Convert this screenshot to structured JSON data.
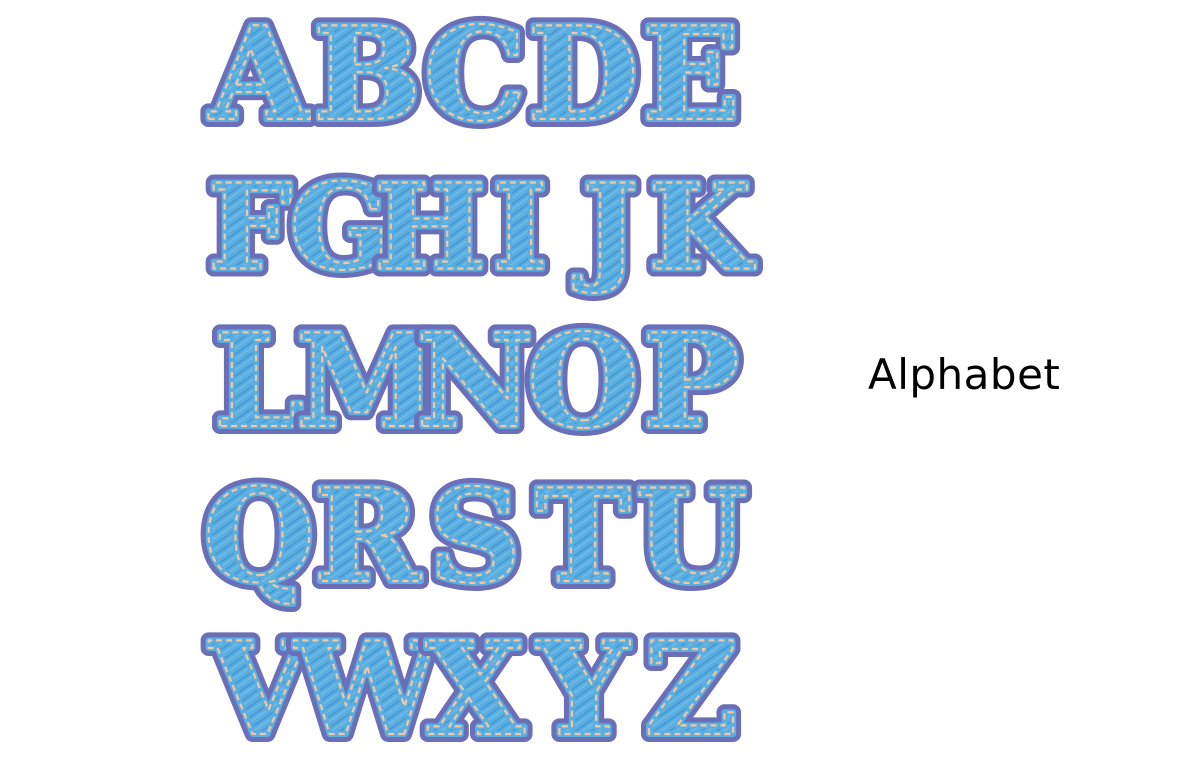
{
  "caption": "Alphabet",
  "letters": [
    [
      "A",
      "B",
      "C",
      "D",
      "E"
    ],
    [
      "F",
      "G",
      "H",
      "I",
      "J",
      "K"
    ],
    [
      "L",
      "M",
      "N",
      "O",
      "P"
    ],
    [
      "Q",
      "R",
      "S",
      "T",
      "U"
    ],
    [
      "V",
      "W",
      "X",
      "Y",
      "Z"
    ]
  ],
  "colors": {
    "fill": "#5aaee0",
    "outline": "#6a6fb8",
    "stitch": "#f2c7a2",
    "hatch": "#3a8fd0",
    "background": "#ffffff"
  }
}
